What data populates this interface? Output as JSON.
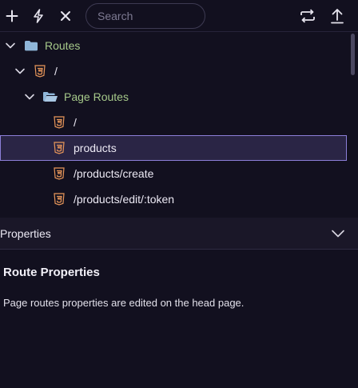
{
  "toolbar": {
    "add_icon": "plus-icon",
    "action_icon": "lightning-icon",
    "close_icon": "close-icon",
    "search_placeholder": "Search",
    "search_value": "",
    "sync_icon": "repeat-icon",
    "upload_icon": "upload-icon"
  },
  "tree": {
    "rows": [
      {
        "label": "Routes",
        "icon": "folder-icon",
        "expanded": true
      },
      {
        "label": "/",
        "icon": "html5-icon",
        "expanded": true
      },
      {
        "label": "Page Routes",
        "icon": "folder-open-icon",
        "expanded": true
      },
      {
        "label": "/",
        "icon": "html5-icon"
      },
      {
        "label": "products",
        "icon": "html5-icon",
        "selected": true
      },
      {
        "label": "/products/create",
        "icon": "html5-icon"
      },
      {
        "label": "/products/edit/:token",
        "icon": "html5-icon"
      }
    ]
  },
  "properties": {
    "header_title": "Properties",
    "section_title": "Route Properties",
    "description": "Page routes properties are edited on the head page."
  },
  "colors": {
    "background": "#12101f",
    "selection": "#2a2545",
    "selection_border": "#8c7fd8",
    "folder_label": "#a6c98a",
    "html5_orange": "#e8965a",
    "folder_blue": "#8fb6d9"
  }
}
